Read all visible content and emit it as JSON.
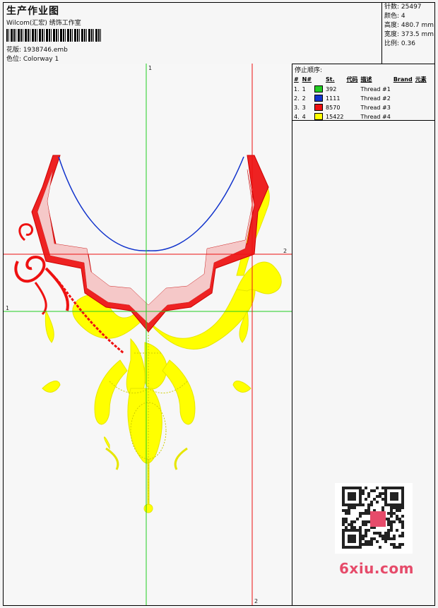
{
  "header": {
    "title": "生产作业图",
    "subtitle": "Wilcom(汇宏) 绣饰工作室",
    "design_label": "花版: 1938746.emb",
    "colorway_label": "色位: Colorway 1"
  },
  "stats": {
    "stitches": "针数: 25497",
    "colors": "颜色: 4",
    "height": "高度: 480.7 mm",
    "width": "宽度: 373.5 mm",
    "scale": "比例: 0.36"
  },
  "stop_sequence": {
    "title": "停止顺序:",
    "headers": [
      "#",
      "N#",
      "",
      "St.",
      "代码",
      "描述",
      "Brand",
      "元素"
    ],
    "rows": [
      {
        "idx": "1.",
        "n": "1",
        "color": "#22cc22",
        "st": "392",
        "desc": "Thread #1"
      },
      {
        "idx": "2.",
        "n": "2",
        "color": "#1133cc",
        "st": "1111",
        "desc": "Thread #2"
      },
      {
        "idx": "3.",
        "n": "3",
        "color": "#ee1111",
        "st": "8570",
        "desc": "Thread #3"
      },
      {
        "idx": "4.",
        "n": "4",
        "color": "#ffff00",
        "st": "15422",
        "desc": "Thread #4"
      }
    ]
  },
  "guides": {
    "top_label": "1",
    "left_label": "1",
    "right_label": "2",
    "bottom_label": "2"
  },
  "watermark": {
    "brand": "6xiu.com"
  }
}
